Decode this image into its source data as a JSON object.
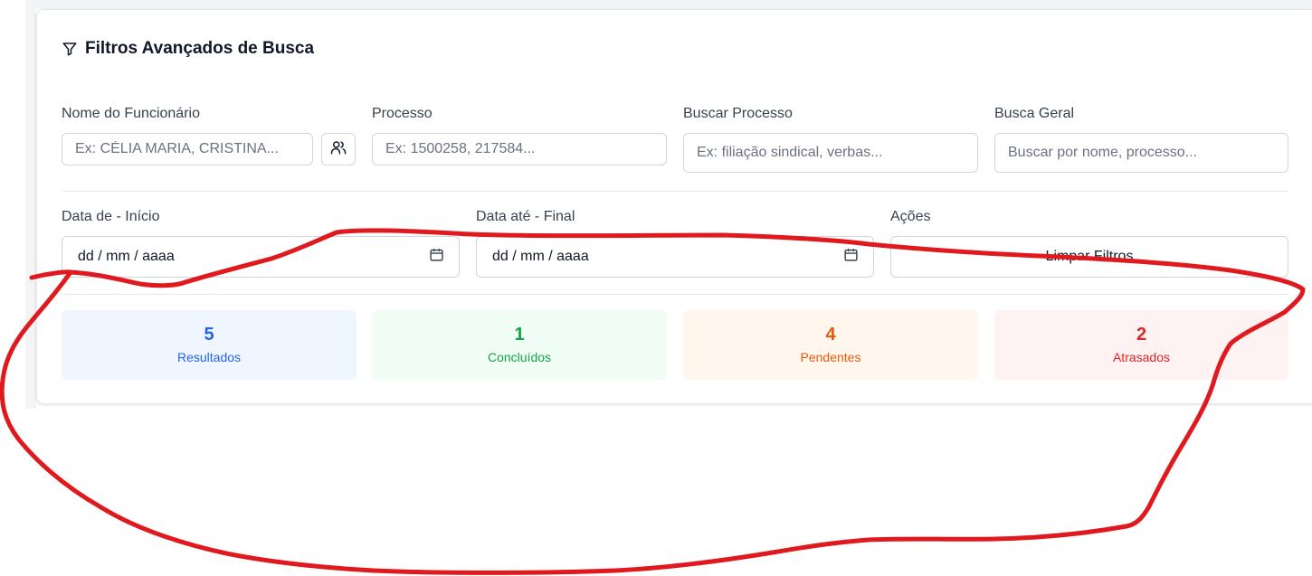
{
  "filters": {
    "title": "Filtros Avançados de Busca",
    "employee": {
      "label": "Nome do Funcionário",
      "placeholder": "Ex: CÉLIA MARIA, CRISTINA..."
    },
    "process": {
      "label": "Processo",
      "placeholder": "Ex: 1500258, 217584..."
    },
    "search_process": {
      "label": "Buscar Processo",
      "placeholder": "Ex: filiação sindical, verbas..."
    },
    "general_search": {
      "label": "Busca Geral",
      "placeholder": "Buscar por nome, processo..."
    },
    "date_start": {
      "label": "Data de - Início",
      "value": "dd / mm / aaaa"
    },
    "date_end": {
      "label": "Data até - Final",
      "value": "dd / mm / aaaa"
    },
    "actions": {
      "label": "Ações",
      "clear_label": "Limpar Filtros"
    }
  },
  "stats": [
    {
      "value": "5",
      "label": "Resultados",
      "color": "#2563eb",
      "bg": "#eff6ff"
    },
    {
      "value": "1",
      "label": "Concluídos",
      "color": "#16a34a",
      "bg": "#f0fdf4"
    },
    {
      "value": "4",
      "label": "Pendentes",
      "color": "#ea580c",
      "bg": "#fff7ed"
    },
    {
      "value": "2",
      "label": "Atrasados",
      "color": "#dc2626",
      "bg": "#fef2f2"
    }
  ],
  "annotation": {
    "color": "#e0191f"
  }
}
